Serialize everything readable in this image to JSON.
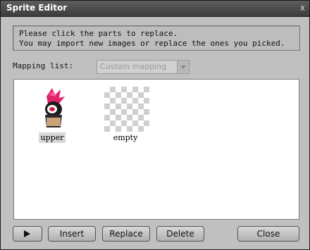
{
  "window": {
    "title": "Sprite Editor",
    "close_glyph": "x"
  },
  "info": {
    "line1": "Please click the parts to replace.",
    "line2": "You may import new images or replace the ones you picked."
  },
  "mapping": {
    "label": "Mapping list:",
    "selected": "Custom mapping"
  },
  "sprites": [
    {
      "label": "upper",
      "selected": true,
      "icon": "character-head-icon"
    },
    {
      "label": "empty",
      "selected": false,
      "icon": "transparent-checker-icon"
    }
  ],
  "buttons": {
    "play_icon": "play-icon",
    "insert": "Insert",
    "replace": "Replace",
    "delete": "Delete",
    "close": "Close"
  }
}
